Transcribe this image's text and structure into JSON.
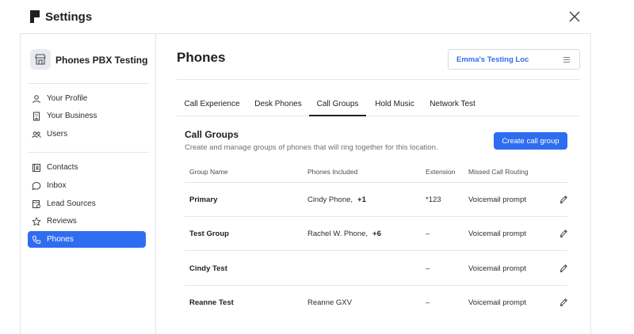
{
  "app": {
    "title": "Settings"
  },
  "sidebar": {
    "business_name": "Phones PBX Testing",
    "group1": [
      {
        "label": "Your Profile",
        "icon": "user-icon"
      },
      {
        "label": "Your Business",
        "icon": "building-icon"
      },
      {
        "label": "Users",
        "icon": "users-icon"
      }
    ],
    "group2": [
      {
        "label": "Contacts",
        "icon": "contacts-icon"
      },
      {
        "label": "Inbox",
        "icon": "chat-bubble-icon"
      },
      {
        "label": "Lead Sources",
        "icon": "lead-sources-icon"
      },
      {
        "label": "Reviews",
        "icon": "star-icon"
      },
      {
        "label": "Phones",
        "icon": "phone-icon",
        "active": true
      }
    ]
  },
  "main": {
    "title": "Phones",
    "location_select": {
      "value": "Emma's Testing Loc"
    },
    "tabs": [
      {
        "label": "Call Experience"
      },
      {
        "label": "Desk Phones"
      },
      {
        "label": "Call Groups",
        "active": true
      },
      {
        "label": "Hold Music"
      },
      {
        "label": "Network Test"
      }
    ],
    "section": {
      "title": "Call Groups",
      "description": "Create and manage groups of phones that will ring together for this location.",
      "create_label": "Create call group"
    },
    "table": {
      "headers": [
        "Group Name",
        "Phones Included",
        "Extension",
        "Missed Call Routing"
      ],
      "rows": [
        {
          "name": "Primary",
          "phones": "Cindy Phone,",
          "more": "+1",
          "extension": "*123",
          "routing": "Voicemail prompt"
        },
        {
          "name": "Test Group",
          "phones": "Rachel W. Phone,",
          "more": "+6",
          "extension": "–",
          "routing": "Voicemail prompt"
        },
        {
          "name": "Cindy Test",
          "phones": "",
          "more": "",
          "extension": "–",
          "routing": "Voicemail prompt"
        },
        {
          "name": "Reanne Test",
          "phones": "Reanne GXV",
          "more": "",
          "extension": "–",
          "routing": "Voicemail prompt"
        }
      ]
    }
  },
  "colors": {
    "accent": "#2f6df0",
    "text": "#1d1f24",
    "border": "#e3e5ea"
  }
}
